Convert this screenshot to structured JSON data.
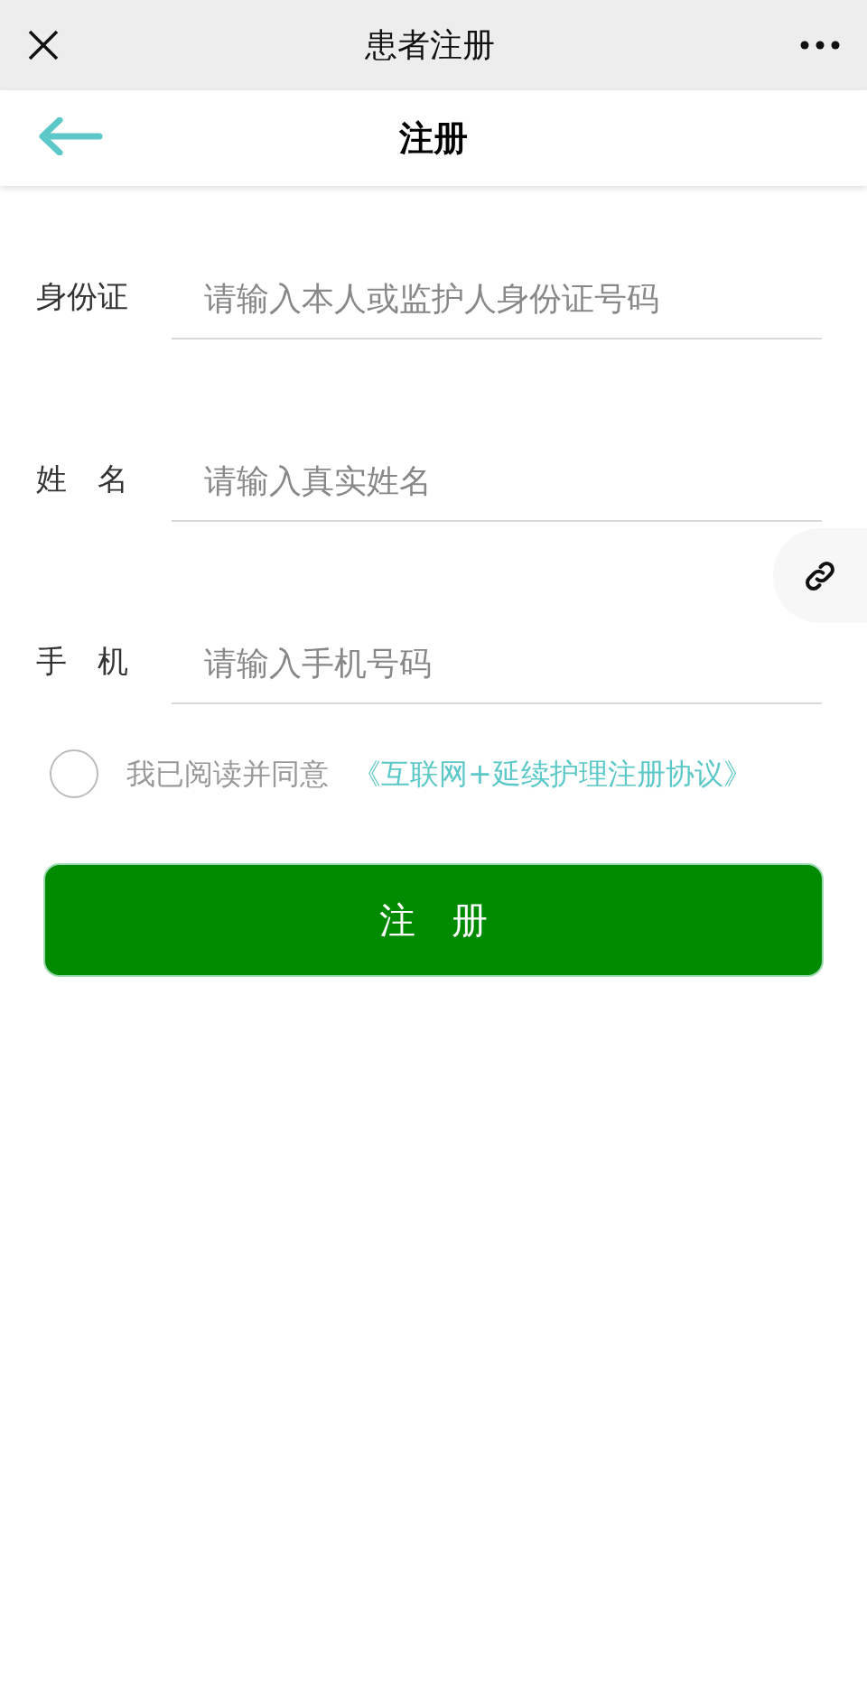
{
  "top_bar": {
    "title": "患者注册"
  },
  "header": {
    "title": "注册"
  },
  "fields": [
    {
      "label": "身份证",
      "placeholder": "请输入本人或监护人身份证号码"
    },
    {
      "label": "姓　名",
      "placeholder": "请输入真实姓名"
    },
    {
      "label": "手　机",
      "placeholder": "请输入手机号码"
    }
  ],
  "agreement": {
    "checked": false,
    "text": "我已阅读并同意",
    "link": "《互联网+延续护理注册协议》"
  },
  "submit_button": {
    "label": "注　册"
  }
}
